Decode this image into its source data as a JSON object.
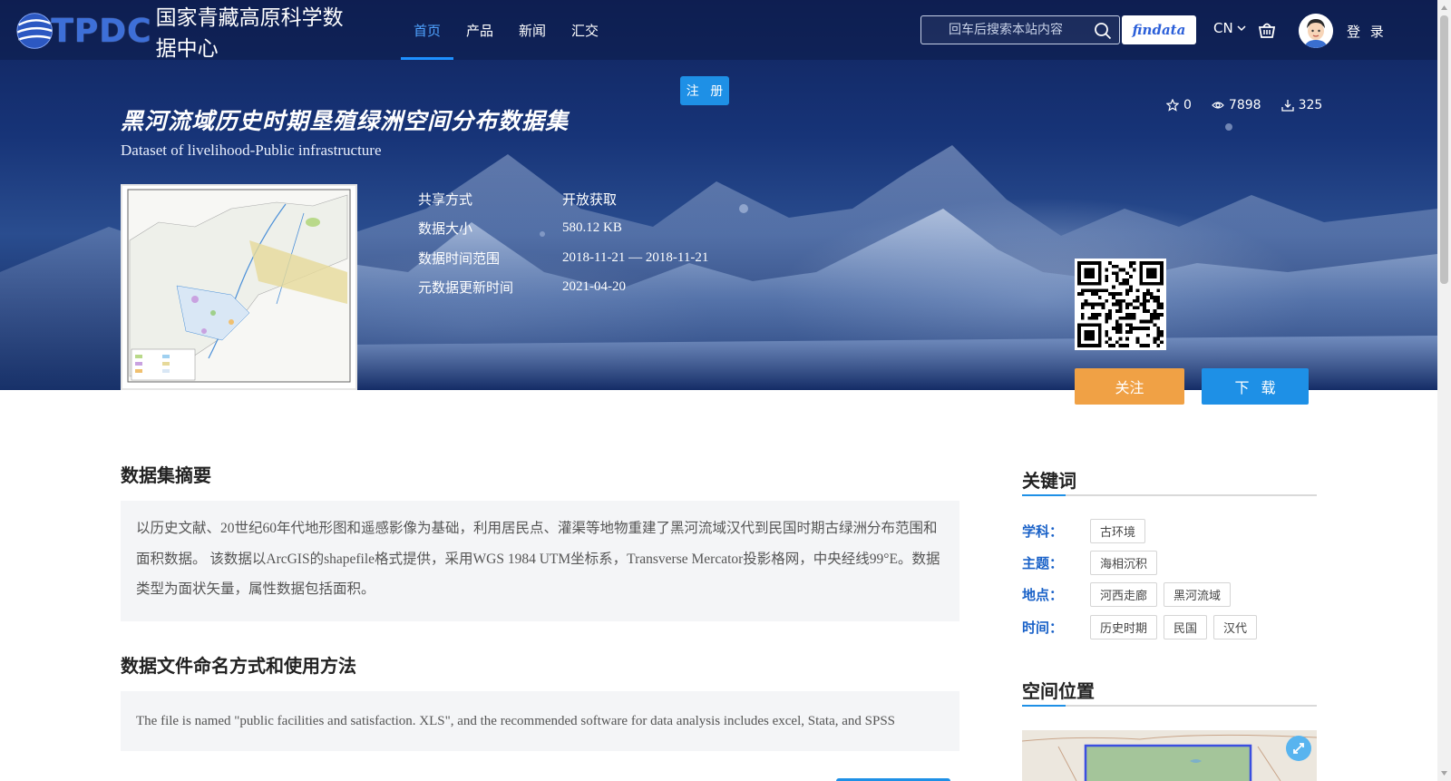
{
  "site": {
    "logo_mark": "TPDC",
    "logo_name": "国家青藏高原科学数据中心"
  },
  "nav": {
    "items": [
      {
        "label": "首页",
        "active": true
      },
      {
        "label": "产品",
        "active": false
      },
      {
        "label": "新闻",
        "active": false
      },
      {
        "label": "汇交",
        "active": false
      }
    ],
    "search_placeholder": "回车后搜索本站内容",
    "findata_label": "findata",
    "language": "CN",
    "login_label": "登 录"
  },
  "hero": {
    "register_label": "注 册",
    "title": "黑河流域历史时期垦殖绿洲空间分布数据集",
    "subtitle": "Dataset of livelihood-Public infrastructure",
    "stats": {
      "favorites": "0",
      "views": "7898",
      "downloads": "325"
    },
    "meta": [
      {
        "label": "共享方式",
        "value": "开放获取"
      },
      {
        "label": "数据大小",
        "value": "580.12 KB"
      },
      {
        "label": "数据时间范围",
        "value": "2018-11-21 — 2018-11-21"
      },
      {
        "label": "元数据更新时间",
        "value": "2021-04-20"
      }
    ],
    "follow_label": "关注",
    "download_label": "下 载"
  },
  "abstract": {
    "title": "数据集摘要",
    "text": "以历史文献、20世纪60年代地形图和遥感影像为基础，利用居民点、灌渠等地物重建了黑河流域汉代到民国时期古绿洲分布范围和面积数据。 该数据以ArcGIS的shapefile格式提供，采用WGS 1984 UTM坐标系，Transverse Mercator投影格网，中央经线99°E。数据类型为面状矢量，属性数据包括面积。"
  },
  "naming": {
    "title": "数据文件命名方式和使用方法",
    "text": "The file is named \"public facilities and satisfaction. XLS\", and the recommended software for data analysis includes excel, Stata, and SPSS"
  },
  "keywords": {
    "title": "关键词",
    "rows": [
      {
        "label": "学科：",
        "tags": [
          "古环境"
        ]
      },
      {
        "label": "主题：",
        "tags": [
          "海相沉积"
        ]
      },
      {
        "label": "地点：",
        "tags": [
          "河西走廊",
          "黑河流域"
        ]
      },
      {
        "label": "时间：",
        "tags": [
          "历史时期",
          "民国",
          "汉代"
        ]
      }
    ]
  },
  "location": {
    "title": "空间位置"
  },
  "colors": {
    "primary": "#1e90e6",
    "follow": "#f0a145",
    "nav_active": "#4fa3ff",
    "keyword_label": "#1a62c8"
  }
}
